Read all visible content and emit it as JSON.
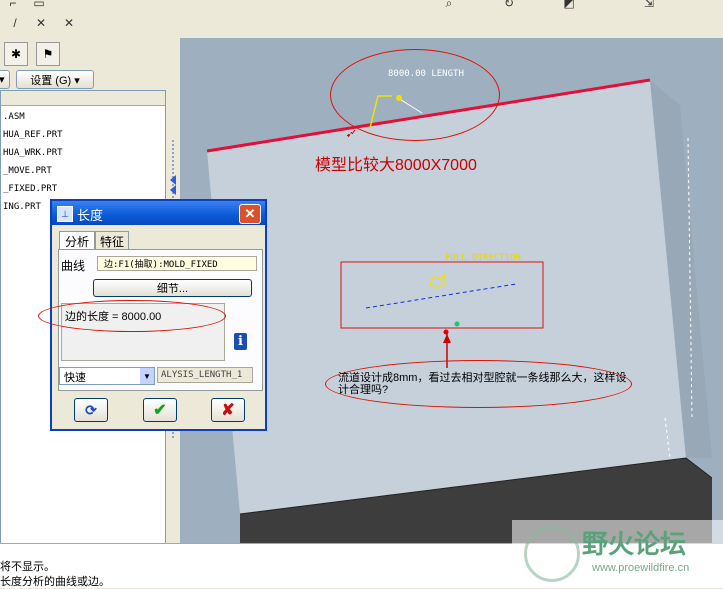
{
  "toolbar": {
    "icons": [
      "pointer-icon",
      "zoom-icon",
      "refresh-icon",
      "undo-icon",
      "redo-icon",
      "view-icon"
    ]
  },
  "left_panel": {
    "settings_label": "设置 (G) ▾",
    "tree_items": [
      ".ASM",
      "HUA_REF.PRT",
      "HUA_WRK.PRT",
      "_MOVE.PRT",
      "_FIXED.PRT",
      "ING.PRT"
    ]
  },
  "viewport": {
    "dimension_label": "8000.00 LENGTH",
    "pull_direction_label": "PULL DIRECTION",
    "annotation_size": "模型比较大8000X7000",
    "annotation_question": "流道设计成8mm，看过去相对型腔就一条线那么大，这样设计合理吗?",
    "colors": {
      "edge": "#e0103a",
      "annotation": "#cc0000",
      "dimension": "#ffffff",
      "pull": "#e8d400",
      "face_front": "#c5d0db",
      "face_side": "#98a8b6",
      "face_bottom": "#3d3d3d"
    }
  },
  "dialog": {
    "title": "长度",
    "tab_analysis": "分析",
    "tab_feature": "特征",
    "curve_label": "曲线",
    "curve_value": "边:F1(抽取):MOLD_FIXED",
    "details_button": "细节...",
    "result_text": "边的长度 = 8000.00",
    "mode_value": "快速",
    "name_value": "ALYSIS_LENGTH_1"
  },
  "status": {
    "line1": "将不显示。",
    "line2": "长度分析的曲线或边。"
  },
  "watermark": {
    "title": "野火论坛",
    "url": "www.proewildfire.cn"
  }
}
